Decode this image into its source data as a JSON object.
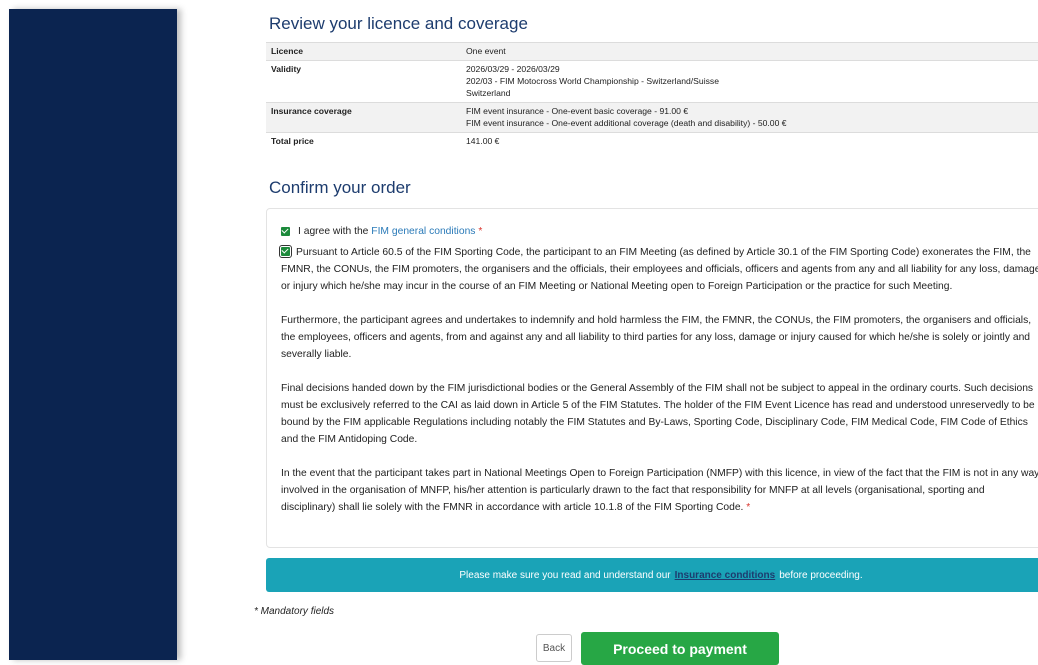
{
  "review": {
    "title": "Review your licence and coverage",
    "rows": [
      {
        "label": "Licence",
        "lines": [
          "One event"
        ]
      },
      {
        "label": "Validity",
        "lines": [
          "2026/03/29 - 2026/03/29",
          "202/03 - FIM Motocross World Championship - Switzerland/Suisse",
          "Switzerland"
        ]
      },
      {
        "label": "Insurance coverage",
        "lines": [
          "FIM event insurance - One-event basic coverage - 91.00 €",
          "FIM event insurance - One-event additional coverage (death and disability) - 50.00 €"
        ]
      },
      {
        "label": "Total price",
        "lines": [
          "141.00 €"
        ]
      }
    ]
  },
  "confirm": {
    "title": "Confirm your order",
    "agree_prefix": "I agree with the",
    "agree_link": "FIM general conditions",
    "required_mark": "*",
    "paragraphs": [
      "Pursuant to Article 60.5 of the FIM Sporting Code, the participant to an FIM Meeting (as defined by Article 30.1 of the FIM Sporting Code) exonerates the FIM, the FMNR, the CONUs, the FIM promoters, the organisers and the officials, their employees and officials, officers and agents from any and all liability for any loss, damage or injury which he/she may incur in the course of an FIM Meeting or National Meeting open to Foreign Participation or the practice for such Meeting.",
      "Furthermore, the participant agrees and undertakes to indemnify and hold harmless the FIM, the FMNR, the CONUs, the FIM promoters, the organisers and officials, the employees, officers and agents, from and against any and all liability to third parties for any loss, damage or injury caused for which he/she is solely or jointly and severally liable.",
      "Final decisions handed down by the FIM jurisdictional bodies or the General Assembly of the FIM shall not be subject to appeal in the ordinary courts. Such decisions must be exclusively referred to the CAI as laid down in Article 5 of the FIM Statutes. The holder of the FIM Event Licence has read and understood unreservedly to be bound by the FIM applicable Regulations including notably the FIM Statutes and By-Laws, Sporting Code, Disciplinary Code, FIM Medical Code, FIM Code of Ethics and the FIM Antidoping Code.",
      "In the event that the participant takes part in National Meetings Open to Foreign Participation (NMFP) with this licence, in view of the fact that the FIM is not in any way involved in the organisation of MNFP, his/her attention is particularly drawn to the fact that responsibility for MNFP at all levels (organisational, sporting and disciplinary) shall lie solely with the FMNR in accordance with article 10.1.8 of the FIM Sporting Code."
    ]
  },
  "banner": {
    "prefix": "Please make sure you read and understand our",
    "link": "Insurance conditions",
    "suffix": "before proceeding."
  },
  "mandatory_note": "* Mandatory fields",
  "buttons": {
    "back": "Back",
    "proceed": "Proceed to payment"
  }
}
